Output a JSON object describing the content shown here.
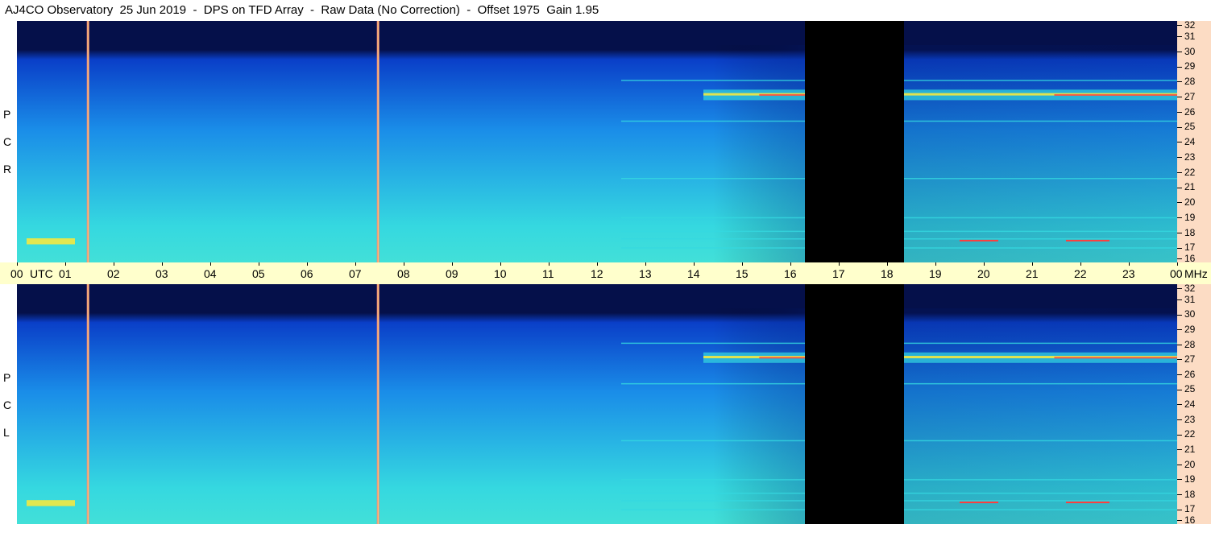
{
  "title": "AJ4CO Observatory  25 Jun 2019  -  DPS on TFD Array  -  Raw Data (No Correction)  -  Offset 1975  Gain 1.95",
  "panels": {
    "rcp_letters": [
      "R",
      "C",
      "P"
    ],
    "lcp_letters": [
      "L",
      "C",
      "P"
    ]
  },
  "freq_unit": "MHz",
  "time_unit": "UTC",
  "colors": {
    "background_dark": "#05104a",
    "low": "#0a3fc8",
    "mid": "#1a8de8",
    "high": "#35d8e0",
    "hot": "#f4e840",
    "peak": "#ff3c3c",
    "timebar": "#ffffcc",
    "freqbar": "#fcdcc4"
  },
  "chart_data": {
    "type": "heatmap",
    "title": "AJ4CO Observatory  25 Jun 2019  -  DPS on TFD Array  -  Raw Data (No Correction)  -  Offset 1975  Gain 1.95",
    "x": {
      "label": "UTC",
      "range_hours": [
        0,
        24
      ],
      "tick_labels": [
        "00",
        "01",
        "02",
        "03",
        "04",
        "05",
        "06",
        "07",
        "08",
        "09",
        "10",
        "11",
        "12",
        "13",
        "14",
        "15",
        "16",
        "17",
        "18",
        "19",
        "20",
        "21",
        "22",
        "23",
        "00"
      ]
    },
    "y": {
      "label": "MHz",
      "range": [
        16,
        32
      ],
      "tick_labels": [
        "32",
        "31",
        "30",
        "29",
        "28",
        "27",
        "26",
        "25",
        "24",
        "23",
        "22",
        "21",
        "20",
        "19",
        "18",
        "17",
        "16"
      ]
    },
    "series": [
      {
        "name": "R C P"
      },
      {
        "name": "L C P"
      }
    ],
    "data_gap_hours": [
      16.3,
      18.35
    ],
    "interference_lines_hours": [
      1.47,
      7.47
    ],
    "strong_band_mhz": 27.1
  }
}
